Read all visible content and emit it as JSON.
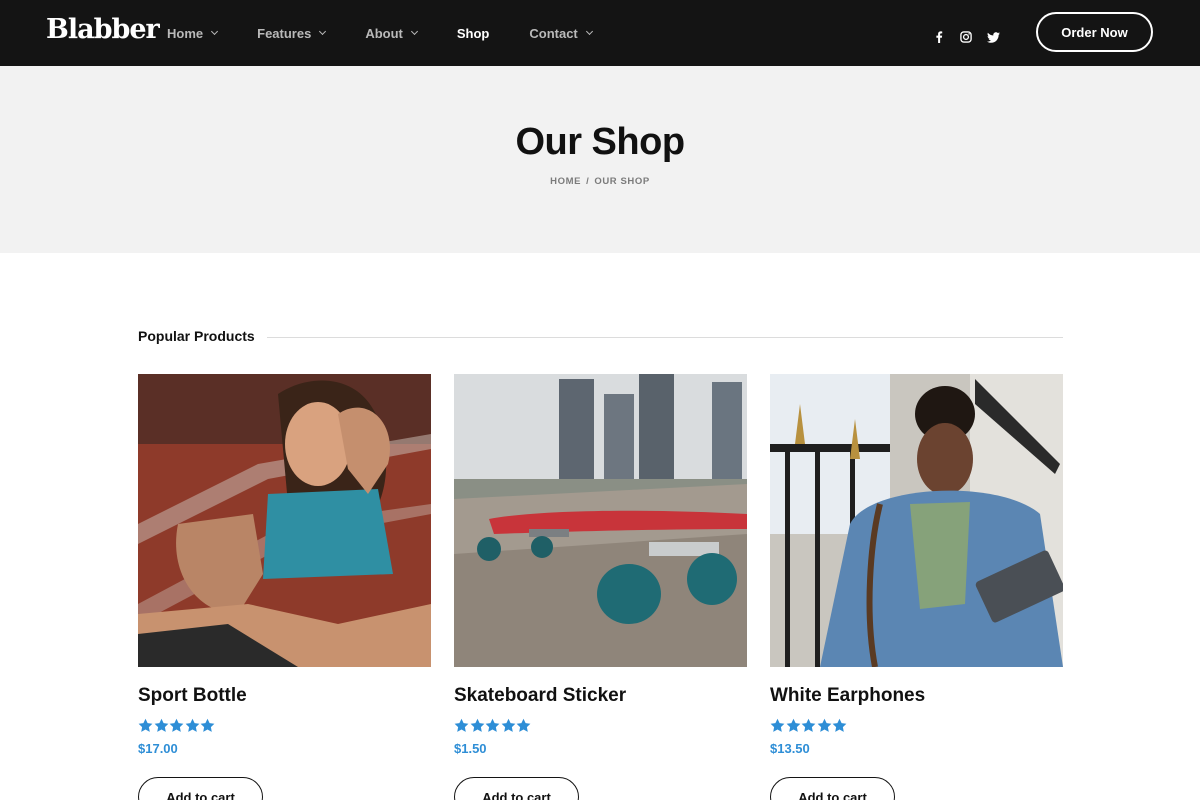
{
  "header": {
    "logo": "Blabber",
    "nav": [
      {
        "label": "Home",
        "dropdown": true
      },
      {
        "label": "Features",
        "dropdown": true
      },
      {
        "label": "About",
        "dropdown": true
      },
      {
        "label": "Shop",
        "dropdown": false,
        "active": true
      },
      {
        "label": "Contact",
        "dropdown": true
      }
    ],
    "socials": [
      "facebook-icon",
      "instagram-icon",
      "twitter-icon"
    ],
    "order_button": "Order Now"
  },
  "hero": {
    "title": "Our Shop",
    "breadcrumb": [
      "HOME",
      "OUR SHOP"
    ],
    "separator": "/"
  },
  "section": {
    "title": "Popular Products"
  },
  "products": [
    {
      "name": "Sport Bottle",
      "price": "$17.00",
      "rating": 5,
      "button": "Add to cart"
    },
    {
      "name": "Skateboard Sticker",
      "price": "$1.50",
      "rating": 5,
      "button": "Add to cart"
    },
    {
      "name": "White Earphones",
      "price": "$13.50",
      "rating": 5,
      "button": "Add to cart"
    }
  ],
  "colors": {
    "header_bg": "#141414",
    "hero_bg": "#f2f2f2",
    "accent": "#2e8ed6"
  }
}
